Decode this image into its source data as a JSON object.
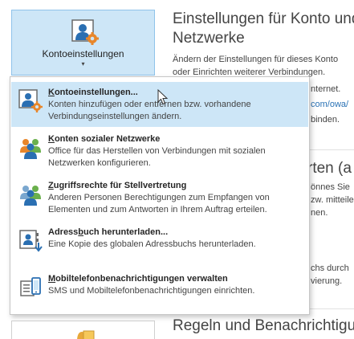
{
  "account_button": {
    "label": "Kontoeinstellungen",
    "caret": "▾",
    "icon": "account-settings-icon"
  },
  "section": {
    "title_line1": "Einstellungen für Konto und",
    "title_line2": "Netzwerke",
    "desc_line1": "Ändern der Einstellungen für dieses Konto",
    "desc_line2": "oder Einrichten weiterer Verbindungen."
  },
  "background_fragments": {
    "internet": "Internet.",
    "owa_link": "com/owa/",
    "binden": "binden.",
    "heading_fragment": "rten (a",
    "line_a": "önnes Sie",
    "line_b": "zw. mitteile",
    "line_c": "nen.",
    "line_d": "chs durch",
    "line_e": "vierung."
  },
  "bottom_section": {
    "title": "Regeln und Benachrichtigung",
    "icon": "rules-alerts-icon"
  },
  "menu": {
    "items": [
      {
        "accel": "K",
        "title_rest": "ontoeinstellungen...",
        "desc1": "Konten hinzufügen oder entfernen bzw. vorhandene",
        "desc2": "Verbindungseinstellungen ändern.",
        "icon": "account-settings-icon"
      },
      {
        "accel": "K",
        "title_rest": "onten sozialer Netzwerke",
        "desc1": "Office für das Herstellen von Verbindungen mit sozialen",
        "desc2": "Netzwerken konfigurieren.",
        "icon": "social-network-people-icon"
      },
      {
        "accel": "Z",
        "title_rest": "ugriffsrechte für Stellvertretung",
        "desc1": "Anderen Personen Berechtigungen zum Empfangen von",
        "desc2": "Elementen und zum Antworten in Ihrem Auftrag erteilen.",
        "icon": "delegate-access-people-icon"
      },
      {
        "title_pre": "Adress",
        "accel": "b",
        "title_rest": "uch herunterladen...",
        "desc1": "Eine Kopie des globalen Adressbuchs herunterladen.",
        "icon": "address-book-download-icon"
      },
      {
        "accel": "M",
        "title_rest": "obiltelefonbenachrichtigungen verwalten",
        "desc1": "SMS und Mobiltelefonbenachrichtigungen einrichten.",
        "icon": "mobile-notifications-icon"
      }
    ]
  },
  "colors": {
    "highlight": "#cde6f7",
    "highlight_border": "#8fc3ea",
    "link": "#2a72b5",
    "gear_orange": "#e8862a",
    "person_blue": "#2a6fb2"
  }
}
